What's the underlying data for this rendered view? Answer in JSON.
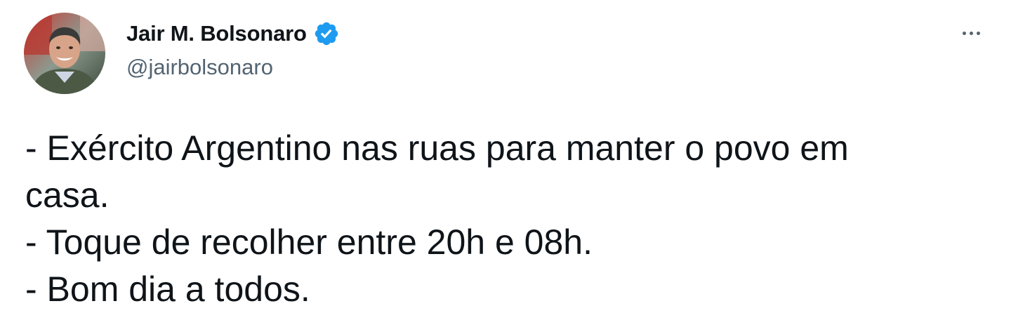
{
  "tweet": {
    "author": {
      "display_name": "Jair M. Bolsonaro",
      "handle": "@jairbolsonaro",
      "verified": true,
      "verified_color": "#1d9bf0"
    },
    "more_icon": "more-options-icon",
    "text_lines": [
      "- Exército Argentino nas ruas para manter o povo em",
      "casa.",
      "- Toque de recolher entre 20h e 08h.",
      "- Bom dia a todos."
    ]
  }
}
